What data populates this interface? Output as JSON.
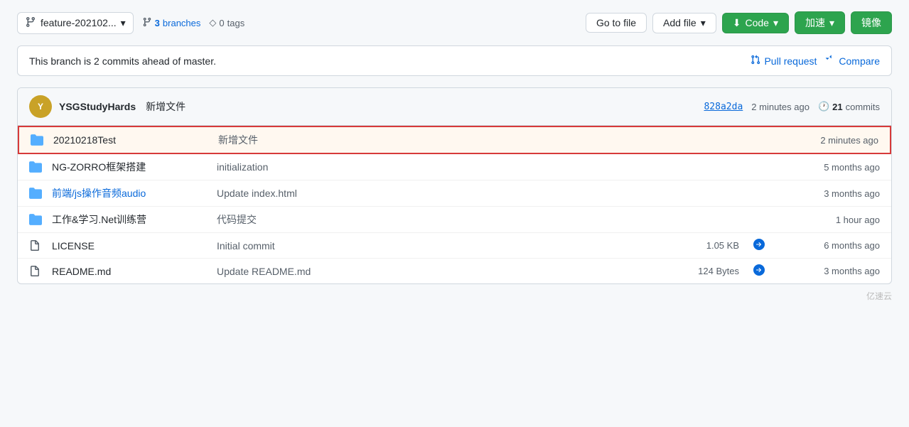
{
  "toolbar": {
    "branch_selector": {
      "icon_label": "branch-icon",
      "name": "feature-20210​2...",
      "dropdown_arrow": "▾"
    },
    "branches": {
      "icon": "⎇",
      "count": "3",
      "label": "branches"
    },
    "tags": {
      "icon": "◇",
      "count": "0",
      "label": "tags"
    },
    "goto_file_label": "Go to file",
    "add_file_label": "Add file",
    "add_file_arrow": "▾",
    "code_label": "Code",
    "code_arrow": "▾",
    "jiasu_label": "加速",
    "jiasu_arrow": "▾",
    "jingxiang_label": "镜像"
  },
  "branch_info": {
    "message": "This branch is 2 commits ahead of master.",
    "pull_request_label": "Pull request",
    "compare_label": "Compare"
  },
  "commit_header": {
    "avatar_initials": "Y",
    "author": "YSGStudyHards",
    "message": "新增文件",
    "hash": "828a2da",
    "time": "2 minutes ago",
    "history_icon": "🕐",
    "commits_count": "21",
    "commits_label": "commits"
  },
  "files": [
    {
      "type": "folder",
      "name": "20210218Test",
      "is_link": false,
      "description": "新增文件",
      "size": "",
      "time": "2 minutes ago",
      "highlighted": true,
      "has_upload": false
    },
    {
      "type": "folder",
      "name": "NG-ZORRO框架搭建",
      "is_link": false,
      "description": "initialization",
      "size": "",
      "time": "5 months ago",
      "highlighted": false,
      "has_upload": false
    },
    {
      "type": "folder",
      "name": "前端/js操作音频audio",
      "is_link": true,
      "description": "Update index.html",
      "size": "",
      "time": "3 months ago",
      "highlighted": false,
      "has_upload": false
    },
    {
      "type": "folder",
      "name": "工作&学习.Net训练营",
      "is_link": false,
      "description": "代码提交",
      "size": "",
      "time": "1 hour ago",
      "highlighted": false,
      "has_upload": false
    },
    {
      "type": "file",
      "name": "LICENSE",
      "is_link": false,
      "description": "Initial commit",
      "size": "1.05 KB",
      "time": "6 months ago",
      "highlighted": false,
      "has_upload": true
    },
    {
      "type": "file",
      "name": "README.md",
      "is_link": false,
      "description": "Update README.md",
      "size": "124 Bytes",
      "time": "3 months ago",
      "highlighted": false,
      "has_upload": true
    }
  ],
  "watermark": "亿速云"
}
